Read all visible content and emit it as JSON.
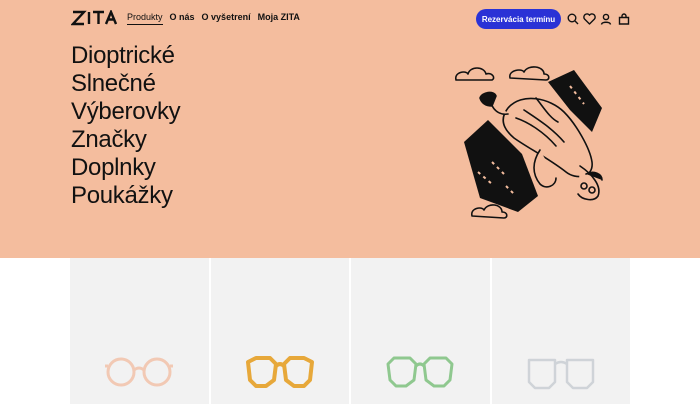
{
  "brand": {
    "logo_text": "ZITA"
  },
  "nav": {
    "items": [
      {
        "label": "Produkty",
        "active": true
      },
      {
        "label": "O nás",
        "active": false
      },
      {
        "label": "O vyšetrení",
        "active": false
      },
      {
        "label": "Moja ZITA",
        "active": false
      }
    ]
  },
  "header": {
    "cta_label": "Rezervácia termínu",
    "icons": [
      "search-icon",
      "heart-icon",
      "user-icon",
      "bag-icon"
    ]
  },
  "hero": {
    "menu": [
      "Dioptrické",
      "Slnečné",
      "Výberovky",
      "Značky",
      "Doplnky",
      "Poukážky"
    ]
  },
  "products": [
    {
      "frame_color": "#f2c9b4"
    },
    {
      "frame_color": "#e7a83a"
    },
    {
      "frame_color": "#8fc88f"
    },
    {
      "frame_color": "#d7dbe0"
    }
  ],
  "colors": {
    "hero_bg": "#f4bd9e",
    "accent": "#2a32d6",
    "card_bg": "#f2f2f2"
  }
}
